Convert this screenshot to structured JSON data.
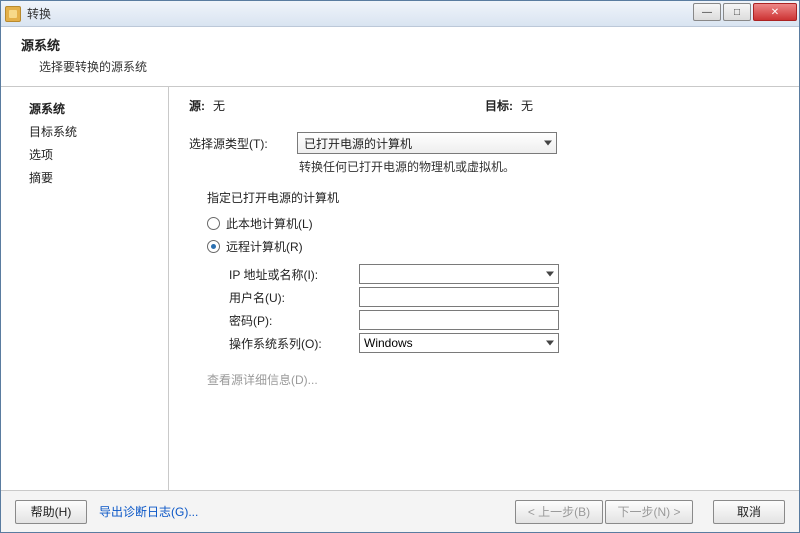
{
  "titlebar": {
    "title": "转换"
  },
  "header": {
    "title": "源系统",
    "subtitle": "选择要转换的源系统"
  },
  "sidebar": {
    "items": [
      {
        "label": "源系统",
        "selected": true
      },
      {
        "label": "目标系统",
        "selected": false
      },
      {
        "label": "选项",
        "selected": false
      },
      {
        "label": "摘要",
        "selected": false
      }
    ]
  },
  "status": {
    "source_label": "源:",
    "source_value": "无",
    "dest_label": "目标:",
    "dest_value": "无"
  },
  "main": {
    "source_type_label": "选择源类型(T):",
    "source_type_value": "已打开电源的计算机",
    "source_type_hint": "转换任何已打开电源的物理机或虚拟机。",
    "group_title": "指定已打开电源的计算机",
    "radio_local": "此本地计算机(L)",
    "radio_remote": "远程计算机(R)",
    "ip_label": "IP 地址或名称(I):",
    "ip_value": "",
    "user_label": "用户名(U):",
    "user_value": "",
    "pass_label": "密码(P):",
    "pass_value": "",
    "os_label": "操作系统系列(O):",
    "os_value": "Windows",
    "detail_link": "查看源详细信息(D)..."
  },
  "bottom": {
    "help": "帮助(H)",
    "export_log": "导出诊断日志(G)...",
    "back": "< 上一步(B)",
    "next": "下一步(N) >",
    "cancel": "取消"
  }
}
